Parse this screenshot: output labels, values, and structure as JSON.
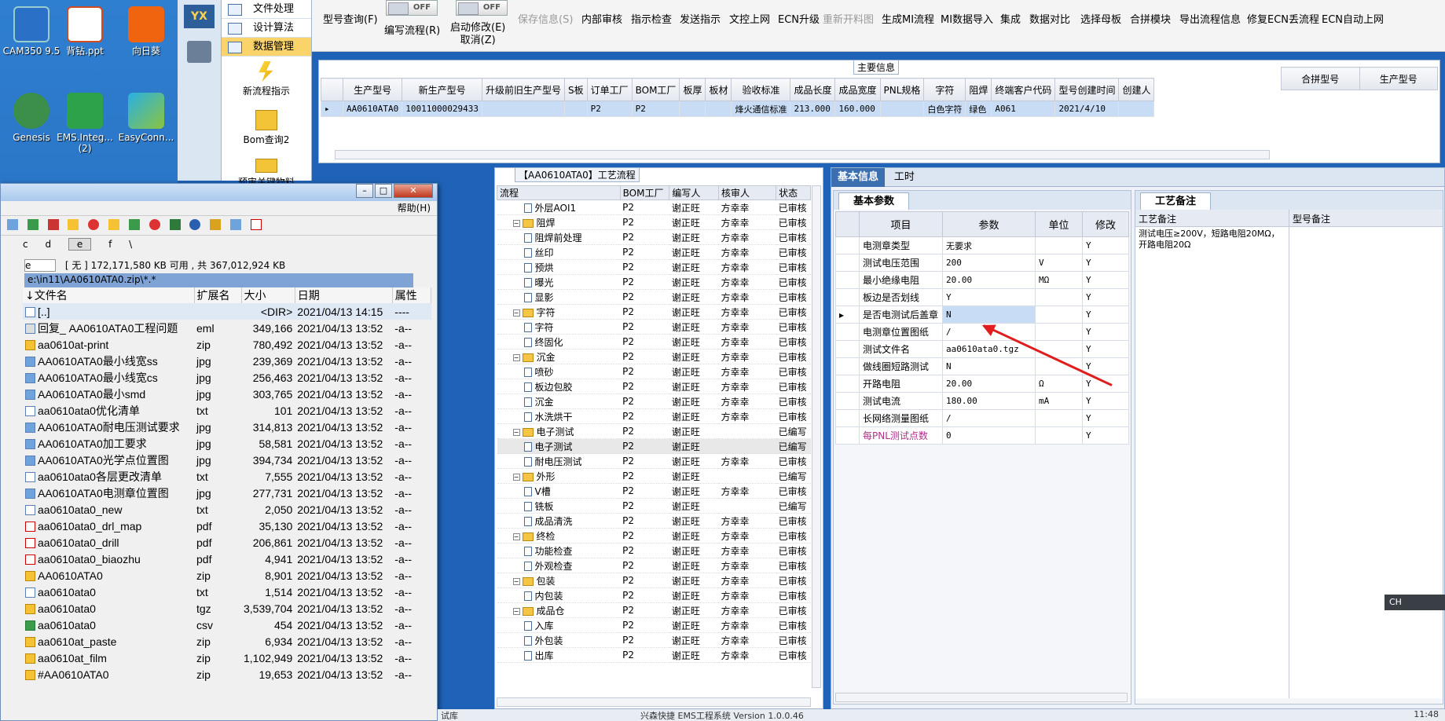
{
  "desktop": {
    "icons": [
      "CAM350 9.5",
      "背钻.ppt",
      "向日葵",
      "Genesis",
      "EMS.Integ...\n(2)",
      "EasyConn..."
    ]
  },
  "leftstrip": {
    "badge": "YX"
  },
  "menupanel": {
    "items": [
      "文件处理",
      "设计算法",
      "数据管理"
    ],
    "big_items": [
      "新流程指示",
      "Bom查询2",
      "预审关键物料"
    ]
  },
  "toolbar": {
    "items": [
      {
        "label": "型号查询(F)",
        "disabled": false
      },
      {
        "label": "编写流程(R)",
        "disabled": false
      },
      {
        "label": "启动修改(E)\n取消(Z)",
        "disabled": false
      },
      {
        "label": "保存信息(S)",
        "disabled": true
      },
      {
        "label": "内部审核",
        "disabled": false
      },
      {
        "label": "指示检查",
        "disabled": false
      },
      {
        "label": "发送指示",
        "disabled": false
      },
      {
        "label": "文控上网",
        "disabled": false
      },
      {
        "label": "ECN升级",
        "disabled": false
      },
      {
        "label": "重新开料图",
        "disabled": true
      },
      {
        "label": "生成MI流程",
        "disabled": false
      },
      {
        "label": "MI数据导入",
        "disabled": false
      },
      {
        "label": "集成",
        "disabled": false
      },
      {
        "label": "数据对比",
        "disabled": false
      },
      {
        "label": "选择母板",
        "disabled": false
      },
      {
        "label": "合拼模块",
        "disabled": false
      },
      {
        "label": "导出流程信息",
        "disabled": false
      },
      {
        "label": "修复ECN丢流程",
        "disabled": false
      },
      {
        "label": "ECN自动上网",
        "disabled": false
      }
    ],
    "toggle1": "OFF",
    "toggle2": "OFF"
  },
  "main_info": {
    "title": "主要信息",
    "columns": [
      "生产型号",
      "新生产型号",
      "升级前旧生产型号",
      "S板",
      "订单工厂",
      "BOM工厂",
      "板厚",
      "板材",
      "验收标准",
      "成品长度",
      "成品宽度",
      "PNL规格",
      "字符",
      "阻焊",
      "终端客户代码",
      "型号创建时间",
      "创建人"
    ],
    "row": [
      "AA0610ATA0",
      "10011000029433",
      "",
      "",
      "P2",
      "P2",
      "",
      "",
      "烽火通信标准",
      "213.000",
      "160.000",
      "",
      "白色字符",
      "绿色",
      "A061",
      "2021/4/10",
      ""
    ],
    "side_columns": [
      "合拼型号",
      "生产型号"
    ]
  },
  "process": {
    "title": "【AA0610ATA0】工艺流程",
    "columns": [
      "流程",
      "BOM工厂",
      "编写人",
      "核审人",
      "状态"
    ],
    "rows": [
      {
        "level": 2,
        "type": "doc",
        "name": "外层AOI1",
        "bom": "P2",
        "writer": "谢正旺",
        "reviewer": "方幸幸",
        "status": "已审核"
      },
      {
        "level": 1,
        "type": "folder",
        "name": "阻焊",
        "bom": "P2",
        "writer": "谢正旺",
        "reviewer": "方幸幸",
        "status": "已审核"
      },
      {
        "level": 2,
        "type": "doc",
        "name": "阻焊前处理",
        "bom": "P2",
        "writer": "谢正旺",
        "reviewer": "方幸幸",
        "status": "已审核"
      },
      {
        "level": 2,
        "type": "doc",
        "name": "丝印",
        "bom": "P2",
        "writer": "谢正旺",
        "reviewer": "方幸幸",
        "status": "已审核"
      },
      {
        "level": 2,
        "type": "doc",
        "name": "预烘",
        "bom": "P2",
        "writer": "谢正旺",
        "reviewer": "方幸幸",
        "status": "已审核"
      },
      {
        "level": 2,
        "type": "doc",
        "name": "曝光",
        "bom": "P2",
        "writer": "谢正旺",
        "reviewer": "方幸幸",
        "status": "已审核"
      },
      {
        "level": 2,
        "type": "doc",
        "name": "显影",
        "bom": "P2",
        "writer": "谢正旺",
        "reviewer": "方幸幸",
        "status": "已审核"
      },
      {
        "level": 1,
        "type": "folder",
        "name": "字符",
        "bom": "P2",
        "writer": "谢正旺",
        "reviewer": "方幸幸",
        "status": "已审核"
      },
      {
        "level": 2,
        "type": "doc",
        "name": "字符",
        "bom": "P2",
        "writer": "谢正旺",
        "reviewer": "方幸幸",
        "status": "已审核"
      },
      {
        "level": 2,
        "type": "doc",
        "name": "终固化",
        "bom": "P2",
        "writer": "谢正旺",
        "reviewer": "方幸幸",
        "status": "已审核"
      },
      {
        "level": 1,
        "type": "folder",
        "name": "沉金",
        "bom": "P2",
        "writer": "谢正旺",
        "reviewer": "方幸幸",
        "status": "已审核"
      },
      {
        "level": 2,
        "type": "doc",
        "name": "喷砂",
        "bom": "P2",
        "writer": "谢正旺",
        "reviewer": "方幸幸",
        "status": "已审核"
      },
      {
        "level": 2,
        "type": "doc",
        "name": "板边包胶",
        "bom": "P2",
        "writer": "谢正旺",
        "reviewer": "方幸幸",
        "status": "已审核"
      },
      {
        "level": 2,
        "type": "doc",
        "name": "沉金",
        "bom": "P2",
        "writer": "谢正旺",
        "reviewer": "方幸幸",
        "status": "已审核"
      },
      {
        "level": 2,
        "type": "doc",
        "name": "水洗烘干",
        "bom": "P2",
        "writer": "谢正旺",
        "reviewer": "方幸幸",
        "status": "已审核"
      },
      {
        "level": 1,
        "type": "folder",
        "name": "电子测试",
        "bom": "P2",
        "writer": "谢正旺",
        "reviewer": "",
        "status": "已编写"
      },
      {
        "level": 2,
        "type": "doc",
        "name": "电子测试",
        "bom": "P2",
        "writer": "谢正旺",
        "reviewer": "",
        "status": "已编写",
        "selected": true
      },
      {
        "level": 2,
        "type": "doc",
        "name": "耐电压测试",
        "bom": "P2",
        "writer": "谢正旺",
        "reviewer": "方幸幸",
        "status": "已审核"
      },
      {
        "level": 1,
        "type": "folder",
        "name": "外形",
        "bom": "P2",
        "writer": "谢正旺",
        "reviewer": "",
        "status": "已编写"
      },
      {
        "level": 2,
        "type": "doc",
        "name": "V槽",
        "bom": "P2",
        "writer": "谢正旺",
        "reviewer": "方幸幸",
        "status": "已审核"
      },
      {
        "level": 2,
        "type": "doc",
        "name": "铣板",
        "bom": "P2",
        "writer": "谢正旺",
        "reviewer": "",
        "status": "已编写"
      },
      {
        "level": 2,
        "type": "doc",
        "name": "成品清洗",
        "bom": "P2",
        "writer": "谢正旺",
        "reviewer": "方幸幸",
        "status": "已审核"
      },
      {
        "level": 1,
        "type": "folder",
        "name": "终检",
        "bom": "P2",
        "writer": "谢正旺",
        "reviewer": "方幸幸",
        "status": "已审核"
      },
      {
        "level": 2,
        "type": "doc",
        "name": "功能检查",
        "bom": "P2",
        "writer": "谢正旺",
        "reviewer": "方幸幸",
        "status": "已审核"
      },
      {
        "level": 2,
        "type": "doc",
        "name": "外观检查",
        "bom": "P2",
        "writer": "谢正旺",
        "reviewer": "方幸幸",
        "status": "已审核"
      },
      {
        "level": 1,
        "type": "folder",
        "name": "包装",
        "bom": "P2",
        "writer": "谢正旺",
        "reviewer": "方幸幸",
        "status": "已审核"
      },
      {
        "level": 2,
        "type": "doc",
        "name": "内包装",
        "bom": "P2",
        "writer": "谢正旺",
        "reviewer": "方幸幸",
        "status": "已审核"
      },
      {
        "level": 1,
        "type": "folder",
        "name": "成品仓",
        "bom": "P2",
        "writer": "谢正旺",
        "reviewer": "方幸幸",
        "status": "已审核"
      },
      {
        "level": 2,
        "type": "doc",
        "name": "入库",
        "bom": "P2",
        "writer": "谢正旺",
        "reviewer": "方幸幸",
        "status": "已审核"
      },
      {
        "level": 2,
        "type": "doc",
        "name": "外包装",
        "bom": "P2",
        "writer": "谢正旺",
        "reviewer": "方幸幸",
        "status": "已审核"
      },
      {
        "level": 2,
        "type": "doc",
        "name": "出库",
        "bom": "P2",
        "writer": "谢正旺",
        "reviewer": "方幸幸",
        "status": "已审核"
      }
    ]
  },
  "basic_info": {
    "tabs": [
      "基本信息",
      "工时"
    ],
    "subtab": "基本参数",
    "columns": [
      "项目",
      "参数",
      "单位",
      "修改"
    ],
    "rows": [
      {
        "item": "电测章类型",
        "value": "无要求",
        "unit": "",
        "mod": "Y"
      },
      {
        "item": "测试电压范围",
        "value": "200",
        "unit": "V",
        "mod": "Y"
      },
      {
        "item": "最小绝缘电阻",
        "value": "20.00",
        "unit": "MΩ",
        "mod": "Y"
      },
      {
        "item": "板边是否划线",
        "value": "Y",
        "unit": "",
        "mod": "Y"
      },
      {
        "item": "是否电测试后盖章",
        "value": "N",
        "unit": "",
        "mod": "Y",
        "selected": true
      },
      {
        "item": "电测章位置图纸",
        "value": "/",
        "unit": "",
        "mod": "Y"
      },
      {
        "item": "测试文件名",
        "value": "aa0610ata0.tgz",
        "unit": "",
        "mod": "Y"
      },
      {
        "item": "做线圈短路测试",
        "value": "N",
        "unit": "",
        "mod": "Y"
      },
      {
        "item": "开路电阻",
        "value": "20.00",
        "unit": "Ω",
        "mod": "Y"
      },
      {
        "item": "测试电流",
        "value": "180.00",
        "unit": "mA",
        "mod": "Y"
      },
      {
        "item": "长网络测量图纸",
        "value": "/",
        "unit": "",
        "mod": "Y"
      },
      {
        "item": "每PNL测试点数",
        "value": "0",
        "unit": "",
        "mod": "Y",
        "highlight": true
      }
    ],
    "remark_tab": "工艺备注",
    "remark_cols": [
      "工艺备注",
      "型号备注"
    ],
    "remark_text": "测试电压≥200V，短路电阻20MΩ，开路电阻20Ω"
  },
  "filewin": {
    "help": "帮助(H)",
    "drives": [
      "c",
      "d",
      "e",
      "f",
      "\\"
    ],
    "drive_select": "e",
    "space": "[ 无 ] 172,171,580 KB 可用 , 共 367,012,924 KB",
    "path": "e:\\in11\\AA0610ATA0.zip\\*.*",
    "columns": [
      "↓文件名",
      "扩展名",
      "大小",
      "日期",
      "属性"
    ],
    "files": [
      {
        "name": "[..]",
        "ext": "",
        "size": "<DIR>",
        "date": "2021/04/13 14:15",
        "attr": "----",
        "icon": "up"
      },
      {
        "name": "回复_ AA0610ATA0工程问题",
        "ext": "eml",
        "size": "349,166",
        "date": "2021/04/13 13:52",
        "attr": "-a--",
        "icon": "eml"
      },
      {
        "name": "aa0610at-print",
        "ext": "zip",
        "size": "780,492",
        "date": "2021/04/13 13:52",
        "attr": "-a--",
        "icon": "zip"
      },
      {
        "name": "AA0610ATA0最小线宽ss",
        "ext": "jpg",
        "size": "239,369",
        "date": "2021/04/13 13:52",
        "attr": "-a--",
        "icon": "jpg"
      },
      {
        "name": "AA0610ATA0最小线宽cs",
        "ext": "jpg",
        "size": "256,463",
        "date": "2021/04/13 13:52",
        "attr": "-a--",
        "icon": "jpg"
      },
      {
        "name": "AA0610ATA0最小smd",
        "ext": "jpg",
        "size": "303,765",
        "date": "2021/04/13 13:52",
        "attr": "-a--",
        "icon": "jpg"
      },
      {
        "name": "aa0610ata0优化清单",
        "ext": "txt",
        "size": "101",
        "date": "2021/04/13 13:52",
        "attr": "-a--",
        "icon": "txt"
      },
      {
        "name": "AA0610ATA0耐电压测试要求",
        "ext": "jpg",
        "size": "314,813",
        "date": "2021/04/13 13:52",
        "attr": "-a--",
        "icon": "jpg"
      },
      {
        "name": "AA0610ATA0加工要求",
        "ext": "jpg",
        "size": "58,581",
        "date": "2021/04/13 13:52",
        "attr": "-a--",
        "icon": "jpg"
      },
      {
        "name": "AA0610ATA0光学点位置图",
        "ext": "jpg",
        "size": "394,734",
        "date": "2021/04/13 13:52",
        "attr": "-a--",
        "icon": "jpg"
      },
      {
        "name": "aa0610ata0各层更改清单",
        "ext": "txt",
        "size": "7,555",
        "date": "2021/04/13 13:52",
        "attr": "-a--",
        "icon": "txt"
      },
      {
        "name": "AA0610ATA0电测章位置图",
        "ext": "jpg",
        "size": "277,731",
        "date": "2021/04/13 13:52",
        "attr": "-a--",
        "icon": "jpg"
      },
      {
        "name": "aa0610ata0_new",
        "ext": "txt",
        "size": "2,050",
        "date": "2021/04/13 13:52",
        "attr": "-a--",
        "icon": "txt"
      },
      {
        "name": "aa0610ata0_drl_map",
        "ext": "pdf",
        "size": "35,130",
        "date": "2021/04/13 13:52",
        "attr": "-a--",
        "icon": "pdf"
      },
      {
        "name": "aa0610ata0_drill",
        "ext": "pdf",
        "size": "206,861",
        "date": "2021/04/13 13:52",
        "attr": "-a--",
        "icon": "pdf"
      },
      {
        "name": "aa0610ata0_biaozhu",
        "ext": "pdf",
        "size": "4,941",
        "date": "2021/04/13 13:52",
        "attr": "-a--",
        "icon": "pdf"
      },
      {
        "name": "AA0610ATA0",
        "ext": "zip",
        "size": "8,901",
        "date": "2021/04/13 13:52",
        "attr": "-a--",
        "icon": "zip"
      },
      {
        "name": "aa0610ata0",
        "ext": "txt",
        "size": "1,514",
        "date": "2021/04/13 13:52",
        "attr": "-a--",
        "icon": "txt"
      },
      {
        "name": "aa0610ata0",
        "ext": "tgz",
        "size": "3,539,704",
        "date": "2021/04/13 13:52",
        "attr": "-a--",
        "icon": "zip"
      },
      {
        "name": "aa0610ata0",
        "ext": "csv",
        "size": "454",
        "date": "2021/04/13 13:52",
        "attr": "-a--",
        "icon": "csv"
      },
      {
        "name": "aa0610at_paste",
        "ext": "zip",
        "size": "6,934",
        "date": "2021/04/13 13:52",
        "attr": "-a--",
        "icon": "zip"
      },
      {
        "name": "aa0610at_film",
        "ext": "zip",
        "size": "1,102,949",
        "date": "2021/04/13 13:52",
        "attr": "-a--",
        "icon": "zip"
      },
      {
        "name": "#AA0610ATA0",
        "ext": "zip",
        "size": "19,653",
        "date": "2021/04/13 13:52",
        "attr": "-a--",
        "icon": "zip"
      }
    ]
  },
  "statusbar": {
    "left": "试库",
    "center": "兴森快捷 EMS工程系统 Version 1.0.0.46",
    "time": "11:48"
  },
  "ime": {
    "label": "CH"
  }
}
